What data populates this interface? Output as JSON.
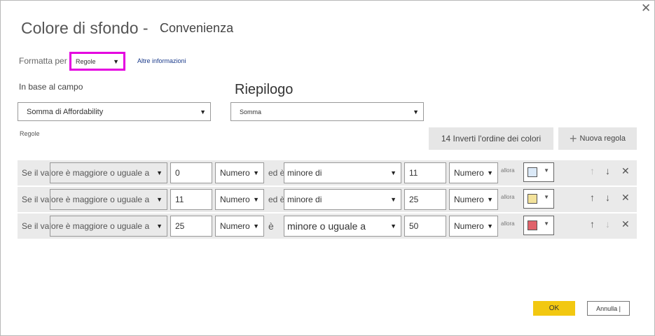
{
  "dialog": {
    "title": "Colore di sfondo -",
    "subtitle": "Convenienza",
    "close_glyph": "✕"
  },
  "format_by": {
    "label": "Formatta per",
    "value": "Regole",
    "learn_more": "Altre informazioni"
  },
  "based_on": {
    "label": "In base al campo",
    "value": "Somma di Affordability"
  },
  "summary": {
    "label": "Riepilogo",
    "value": "Somma"
  },
  "rules_label": "Regole",
  "buttons": {
    "reverse_colors": "14 Inverti l'ordine dei colori",
    "new_rule_icon": "+",
    "new_rule": "Nuova regola",
    "ok": "OK",
    "cancel": "Annulla |"
  },
  "rules": [
    {
      "prefix": "Se il valore è maggiore o uguale a",
      "op1_value": "0",
      "type1": "Numero",
      "connector": "ed è",
      "op2": "minore di",
      "op2_value": "11",
      "type2": "Numero",
      "then": "allora",
      "color": "#dbe9f7"
    },
    {
      "prefix": "Se il valore è maggiore o uguale a",
      "op1_value": "11",
      "type1": "Numero",
      "connector": "ed è",
      "op2": "minore di",
      "op2_value": "25",
      "type2": "Numero",
      "then": "allora",
      "color": "#f3e29b"
    },
    {
      "prefix": "Se il valore è maggiore o uguale a",
      "op1_value": "25",
      "type1": "Numero",
      "connector": "è",
      "op2": "minore o uguale a",
      "op2_value": "50",
      "type2": "Numero",
      "then": "allora",
      "color": "#e0636b"
    }
  ],
  "icons": {
    "dropdown": "▼",
    "move_up": "↑",
    "move_down": "↓",
    "delete": "✕"
  }
}
